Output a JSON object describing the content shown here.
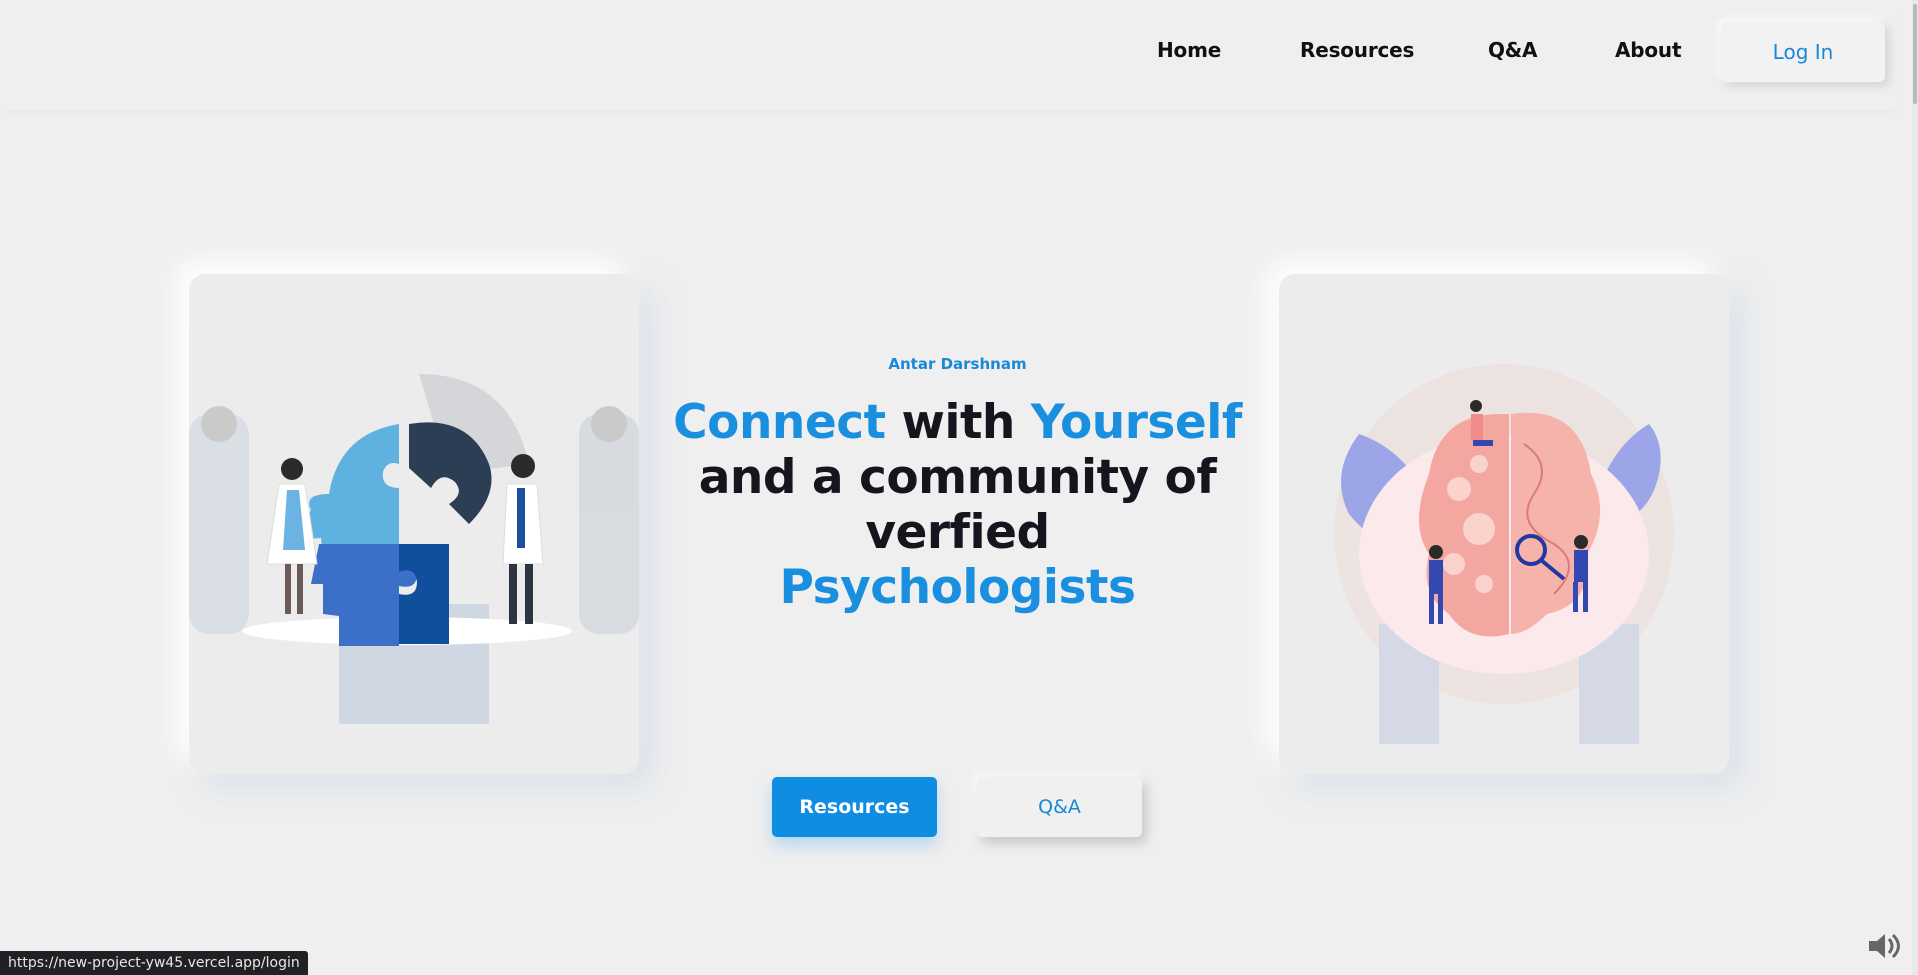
{
  "nav": {
    "home": "Home",
    "resources": "Resources",
    "qa": "Q&A",
    "about": "About",
    "login": "Log In"
  },
  "hero": {
    "brand": "Antar Darshnam",
    "headline": {
      "connect": "Connect",
      "with": "with",
      "yourself": "Yourself",
      "line2": "and a community of",
      "line3": "verfied",
      "line4": "Psychologists"
    },
    "primary_button": "Resources",
    "secondary_button": "Q&A"
  },
  "status_bar": {
    "url": "https://new-project-yw45.vercel.app/login"
  },
  "colors": {
    "accent": "#1789d6",
    "primary_button": "#0f8de3",
    "text_dark": "#15161d",
    "background": "#efefef"
  },
  "icons": {
    "left_card": "puzzle-head-illustration",
    "right_card": "brain-gears-illustration",
    "audio": "speaker-icon"
  }
}
